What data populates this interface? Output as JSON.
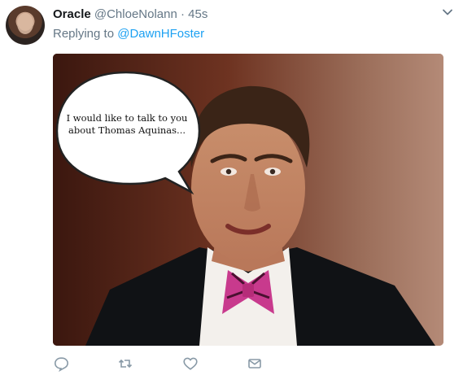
{
  "tweet": {
    "display_name": "Oracle",
    "handle": "@ChloeNolann",
    "separator": "·",
    "time": "45s",
    "replying_prefix": "Replying to",
    "replying_to": "@DawnHFoster"
  },
  "media": {
    "speech_bubble_text": "I would like to talk to you about Thomas Aquinas..."
  },
  "actions": {
    "icons": [
      "reply-icon",
      "retweet-icon",
      "like-icon",
      "message-icon"
    ]
  },
  "colors": {
    "link": "#1da1f2",
    "muted": "#657786",
    "name": "#14171a"
  }
}
